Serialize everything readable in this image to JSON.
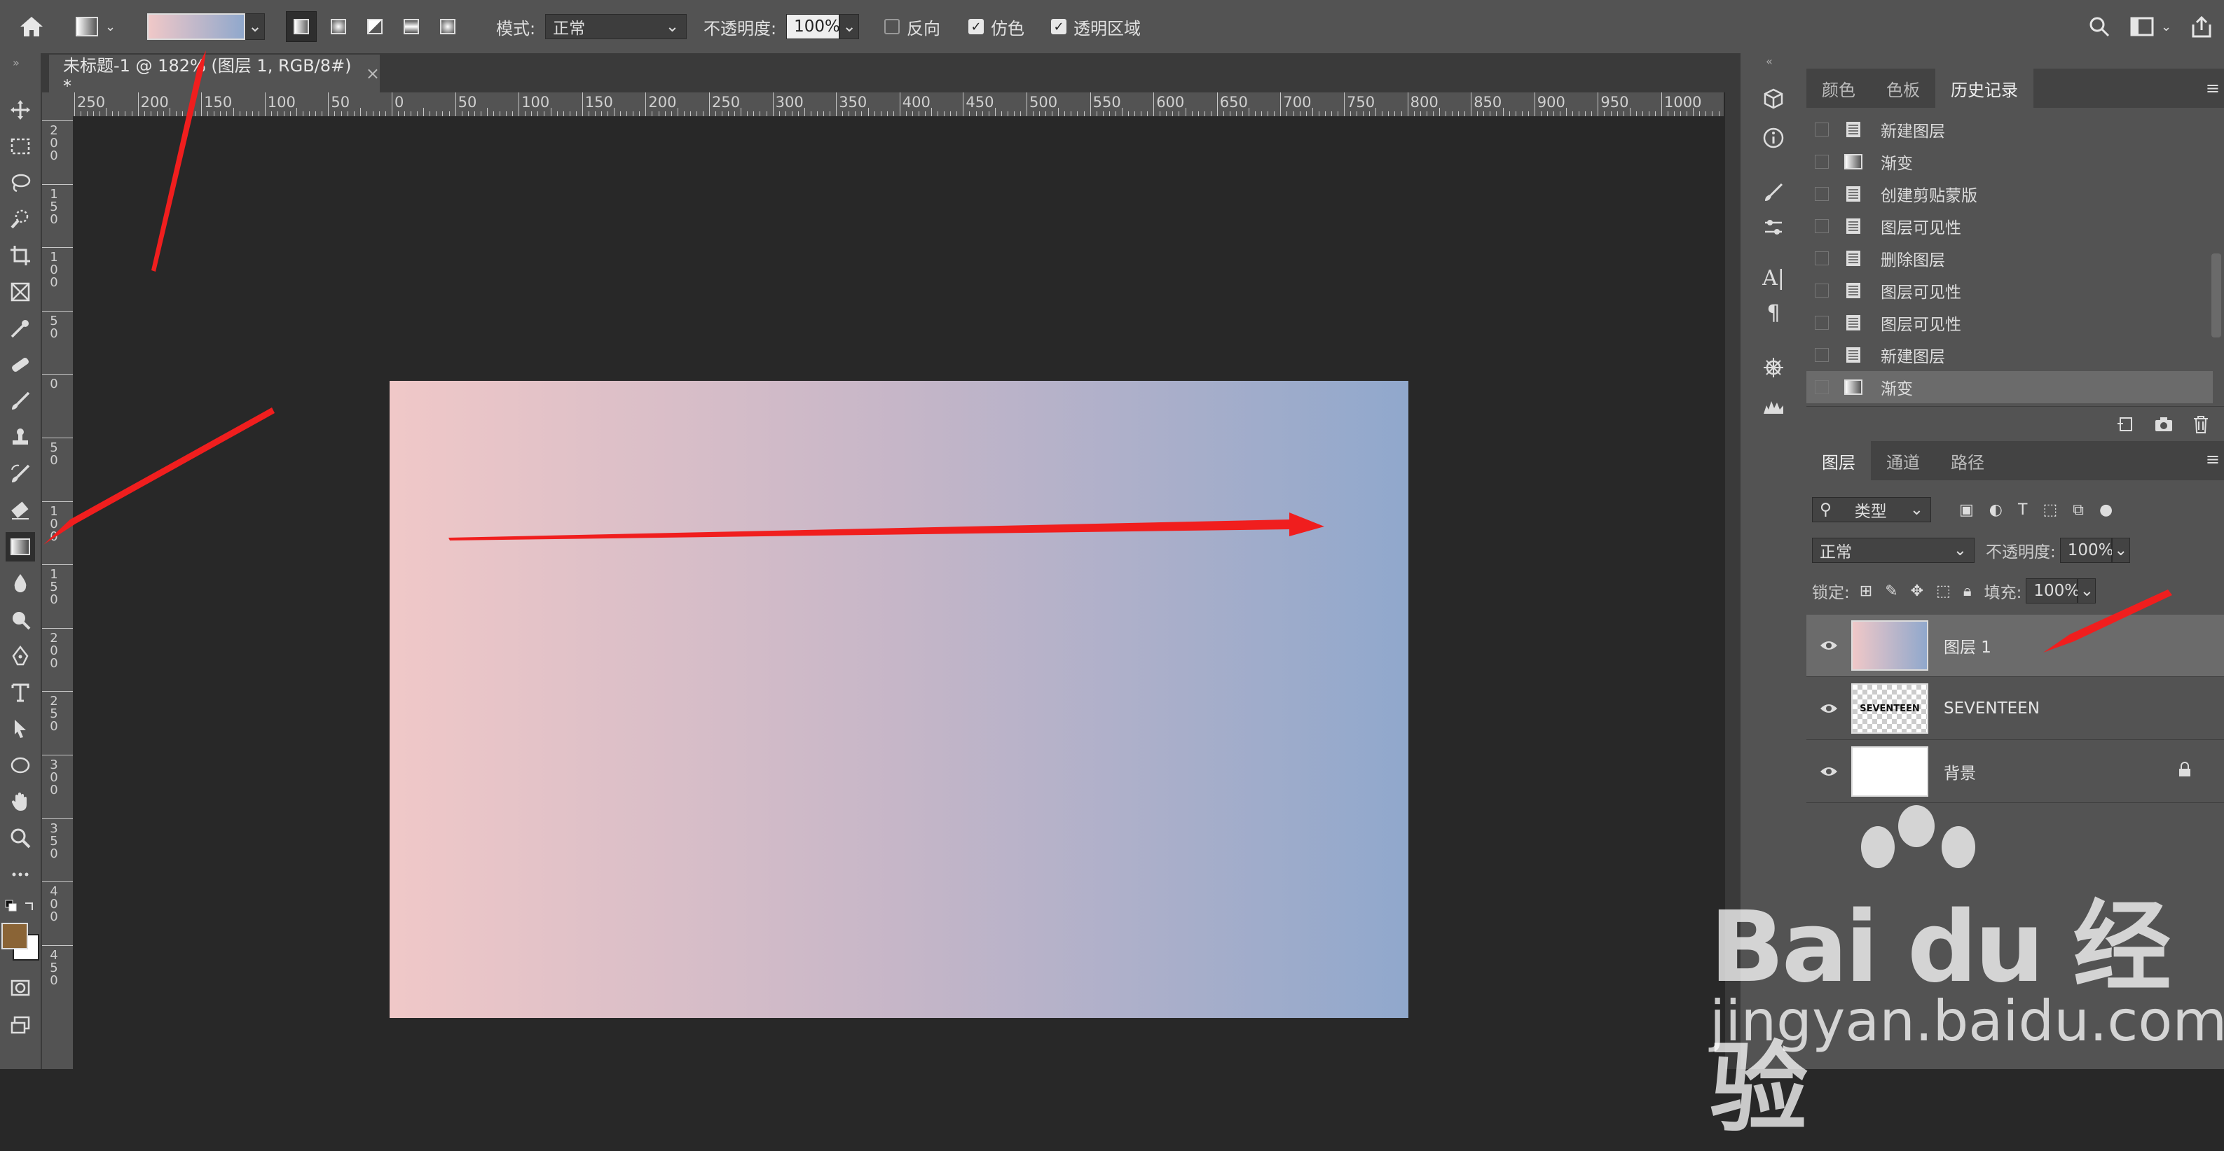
{
  "options_bar": {
    "mode_label": "模式:",
    "mode_value": "正常",
    "opacity_label": "不透明度:",
    "opacity_value": "100%",
    "reverse_label": "反向",
    "dither_label": "仿色",
    "transparency_label": "透明区域",
    "reverse_checked": false,
    "dither_checked": true,
    "transparency_checked": true,
    "gradient_colors": [
      "#f0c8c8",
      "#90a8cc"
    ]
  },
  "document": {
    "tab_title": "未标题-1 @ 182% (图层 1, RGB/8#) *",
    "close_label": "×",
    "canvas_gradient": [
      "#f0c8c8",
      "#c6b6c8",
      "#90a8cc"
    ]
  },
  "rulers": {
    "horizontal_labels": [
      "250",
      "200",
      "150",
      "100",
      "50",
      "0",
      "50",
      "100",
      "150",
      "200",
      "250",
      "300",
      "350",
      "400",
      "450",
      "500",
      "550",
      "600",
      "650",
      "700",
      "750",
      "800",
      "850",
      "900",
      "950",
      "1000"
    ],
    "vertical_labels": [
      "200",
      "150",
      "100",
      "50",
      "0",
      "50",
      "100",
      "150",
      "200",
      "250",
      "300",
      "350",
      "400",
      "450"
    ]
  },
  "history_panel": {
    "tabs": [
      "颜色",
      "色板",
      "历史记录"
    ],
    "active_tab": "历史记录",
    "items": [
      "新建图层",
      "渐变",
      "创建剪贴蒙版",
      "图层可见性",
      "删除图层",
      "图层可见性",
      "图层可见性",
      "新建图层",
      "渐变"
    ]
  },
  "layers_panel": {
    "tabs": [
      "图层",
      "通道",
      "路径"
    ],
    "active_tab": "图层",
    "filter_label": "类型",
    "blend_mode": "正常",
    "opacity_label": "不透明度:",
    "opacity_value": "100%",
    "lock_label": "锁定:",
    "fill_label": "填充:",
    "fill_value": "100%",
    "layers": [
      {
        "name": "图层 1",
        "selected": true,
        "thumb_text": ""
      },
      {
        "name": "SEVENTEEN",
        "selected": false,
        "thumb_text": "SEVENTEEN"
      },
      {
        "name": "背景",
        "selected": false,
        "thumb_text": ""
      }
    ]
  },
  "watermark": {
    "brand_line": "Bai du 经验",
    "url": "jingyan.baidu.com"
  },
  "colors": {
    "foreground": "#8a6436",
    "background": "#ffffff",
    "annotation_arrow": "#f01e1e"
  },
  "icons": [
    "home-icon",
    "gradient-tool-icon",
    "move-icon",
    "marquee-icon",
    "lasso-icon",
    "quick-select-icon",
    "crop-icon",
    "frame-icon",
    "eyedropper-icon",
    "healing-icon",
    "brush-icon",
    "stamp-icon",
    "history-brush-icon",
    "eraser-icon",
    "gradient-icon",
    "blur-icon",
    "dodge-icon",
    "pen-icon",
    "type-icon",
    "path-select-icon",
    "ellipse-icon",
    "hand-icon",
    "zoom-icon",
    "more-icon",
    "search-icon",
    "workspace-icon",
    "share-icon",
    "eye-icon",
    "lock-icon",
    "trash-icon",
    "camera-icon"
  ]
}
